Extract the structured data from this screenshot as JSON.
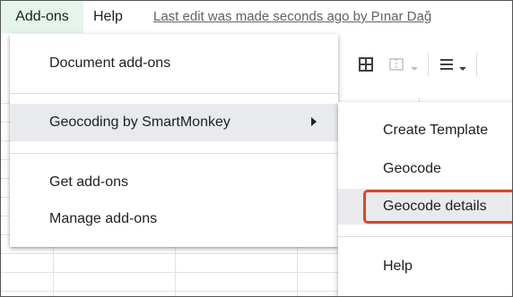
{
  "menubar": {
    "items": [
      "Add-ons",
      "Help"
    ],
    "last_edit": "Last edit was made seconds ago by Pınar Dağ"
  },
  "addons_menu": {
    "items": [
      {
        "label": "Document add-ons"
      },
      {
        "label": "Geocoding by SmartMonkey",
        "has_submenu": true,
        "submenu_icon": "triangle-right-icon"
      },
      {
        "label": "Get add-ons"
      },
      {
        "label": "Manage add-ons"
      }
    ]
  },
  "geocoding_submenu": {
    "items": [
      {
        "label": "Create Template"
      },
      {
        "label": "Geocode"
      },
      {
        "label": "Geocode details",
        "highlighted": true
      },
      {
        "label": "Help"
      }
    ]
  },
  "toolbar": {
    "icons": [
      "table-grid-icon",
      "merge-cells-icon",
      "dropdown-icon",
      "align-icon",
      "dropdown-icon"
    ]
  },
  "colors": {
    "active_menu_bg": "#e6f4ea",
    "hover_bg": "#e8eaed",
    "callout_border": "#d9452b"
  }
}
